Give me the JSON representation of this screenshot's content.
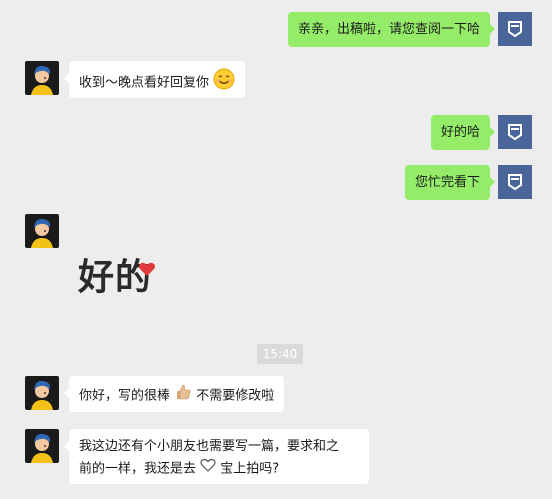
{
  "messages": {
    "m1": "亲亲，出稿啦，请您查阅一下哈",
    "m2": "收到～晚点看好回复你",
    "m3": "好的哈",
    "m4": "您忙完看下",
    "m5_sticker": "好的",
    "time": "15:40",
    "m6_a": "你好，写的很棒",
    "m6_b": "不需要修改啦",
    "m7_line1": "我这边还有个小朋友也需要写一篇，要求和之",
    "m7_line2a": "前的一样，我还是去",
    "m7_line2b": "宝上拍吗?"
  },
  "icons": {
    "smile": "smiling-face-icon",
    "thumbs": "thumbs-up-icon",
    "heart": "heart-icon"
  },
  "colors": {
    "background": "#ededed",
    "green_bubble": "#95ec69",
    "white_bubble": "#ffffff",
    "self_avatar": "#4a6599"
  }
}
